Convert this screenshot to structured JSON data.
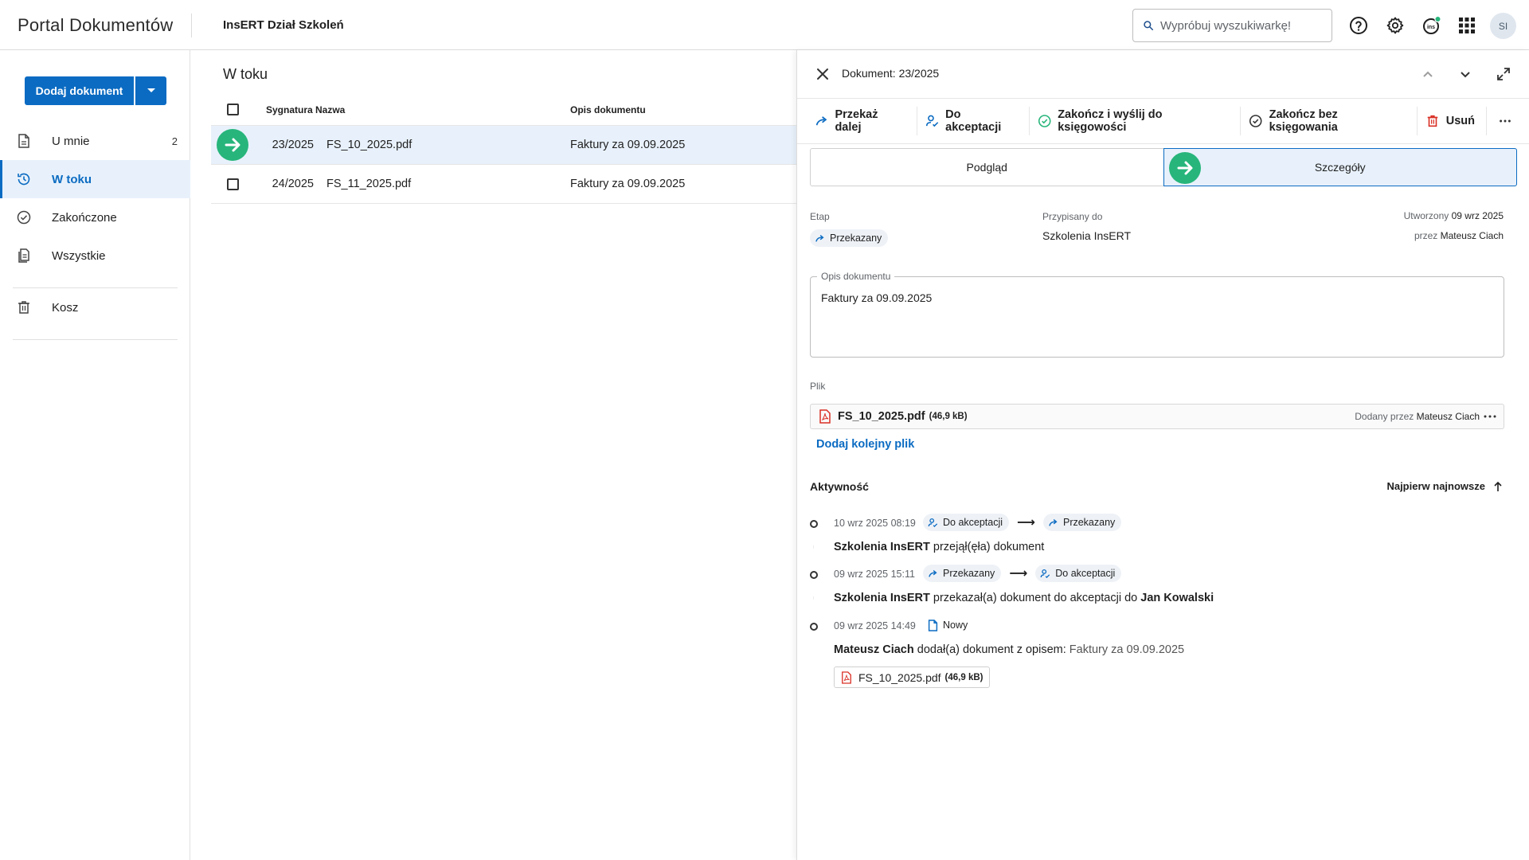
{
  "header": {
    "app_title": "Portal Dokumentów",
    "org_name": "InsERT Dział Szkoleń",
    "search_placeholder": "Wypróbuj wyszukiwarkę!",
    "avatar_initials": "SI"
  },
  "sidebar": {
    "add_button": "Dodaj dokument",
    "items": [
      {
        "label": "U mnie",
        "count": "2",
        "icon": "document-icon"
      },
      {
        "label": "W toku",
        "count": "",
        "icon": "clock-icon",
        "active": true
      },
      {
        "label": "Zakończone",
        "count": "",
        "icon": "check-circle-icon"
      },
      {
        "label": "Wszystkie",
        "count": "",
        "icon": "documents-icon"
      },
      {
        "label": "Kosz",
        "count": "",
        "icon": "trash-icon"
      }
    ]
  },
  "main": {
    "title": "W toku",
    "columns": [
      "Sygnatura",
      "Nazwa",
      "Opis dokumentu"
    ],
    "rows": [
      {
        "sig": "23/2025",
        "name": "FS_10_2025.pdf",
        "desc": "Faktury za 09.09.2025",
        "selected": true
      },
      {
        "sig": "24/2025",
        "name": "FS_11_2025.pdf",
        "desc": "Faktury za 09.09.2025",
        "selected": false
      }
    ]
  },
  "panel": {
    "title": "Dokument: 23/2025",
    "toolbar": {
      "forward": "Przekaż dalej",
      "to_accept": "Do akceptacji",
      "finish_send": "Zakończ i wyślij do księgowości",
      "finish_no_post": "Zakończ bez księgowania",
      "delete": "Usuń"
    },
    "tabs": {
      "preview": "Podgląd",
      "details": "Szczegóły"
    },
    "stage_label": "Etap",
    "stage_value": "Przekazany",
    "assigned_label": "Przypisany do",
    "assigned_value": "Szkolenia InsERT",
    "created_label": "Utworzony",
    "created_date": "09 wrz 2025",
    "created_by_label": "przez",
    "created_by": "Mateusz Ciach",
    "desc_label": "Opis dokumentu",
    "desc_value": "Faktury za 09.09.2025",
    "file_label": "Plik",
    "file_name": "FS_10_2025.pdf",
    "file_size": "(46,9 kB)",
    "file_added_label": "Dodany przez",
    "file_added_by": "Mateusz Ciach",
    "add_file": "Dodaj kolejny plik",
    "activity_title": "Aktywność",
    "activity_sort": "Najpierw najnowsze",
    "activities": [
      {
        "time": "10 wrz 2025 08:19",
        "from": "Do akceptacji",
        "to": "Przekazany",
        "actor": "Szkolenia InsERT",
        "text": "przejął(ęła) dokument"
      },
      {
        "time": "09 wrz 2025 15:11",
        "from": "Przekazany",
        "to": "Do akceptacji",
        "actor": "Szkolenia InsERT",
        "text": "przekazał(a) dokument do akceptacji do",
        "target": "Jan Kowalski"
      },
      {
        "time": "09 wrz 2025 14:49",
        "from": "Nowy",
        "actor": "Mateusz Ciach",
        "text": "dodał(a) dokument z opisem:",
        "extra": "Faktury za 09.09.2025",
        "file_name": "FS_10_2025.pdf",
        "file_size": "(46,9 kB)"
      }
    ]
  },
  "colors": {
    "accent": "#0b6bc2",
    "green": "#27b57b",
    "selected_bg": "#e8f1fb",
    "danger": "#d93025"
  }
}
